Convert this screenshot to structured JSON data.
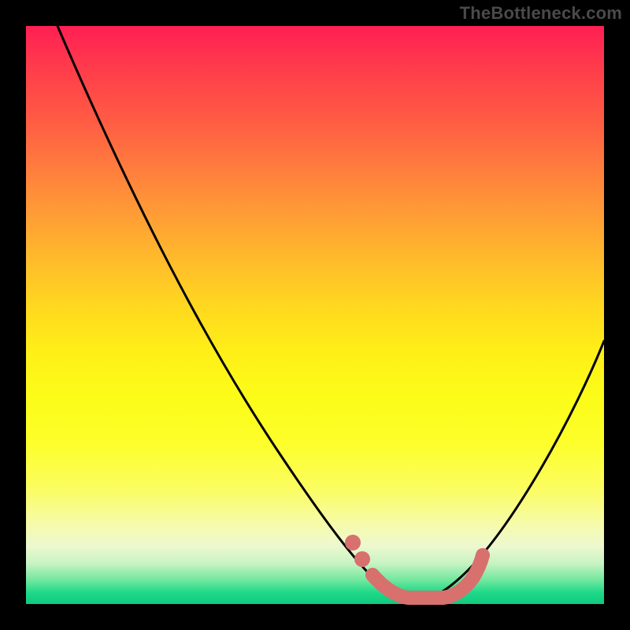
{
  "watermark": "TheBottleneck.com",
  "colors": {
    "curve": "#000000",
    "overlay": "#d8706e",
    "frame_bg": "#000000"
  },
  "chart_data": {
    "type": "line",
    "title": "",
    "xlabel": "",
    "ylabel": "",
    "xlim": [
      0,
      100
    ],
    "ylim": [
      0,
      100
    ],
    "series": [
      {
        "name": "left-curve",
        "x": [
          5,
          10,
          15,
          20,
          25,
          30,
          35,
          40,
          45,
          50,
          55,
          58,
          60,
          62,
          64,
          66,
          68
        ],
        "y": [
          100,
          92,
          83,
          74,
          65,
          56,
          47,
          38,
          29,
          20,
          12,
          8,
          5.5,
          3.5,
          2,
          1,
          0.4
        ]
      },
      {
        "name": "right-curve",
        "x": [
          68,
          72,
          76,
          80,
          84,
          88,
          92,
          96,
          100
        ],
        "y": [
          0.4,
          2,
          5,
          10,
          17,
          25,
          34,
          43,
          52
        ]
      }
    ],
    "highlight": {
      "name": "optimal-range",
      "points": [
        {
          "x": 56,
          "y": 10
        },
        {
          "x": 58,
          "y": 7
        },
        {
          "x": 61,
          "y": 3.5
        },
        {
          "x": 66,
          "y": 1
        },
        {
          "x": 72,
          "y": 1
        },
        {
          "x": 76,
          "y": 3
        },
        {
          "x": 78,
          "y": 6
        }
      ]
    }
  }
}
